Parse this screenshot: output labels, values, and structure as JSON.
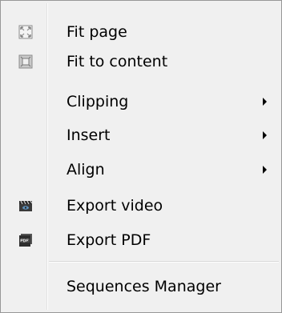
{
  "menu": {
    "items": [
      {
        "label": "Fit page",
        "icon": "fit-page-icon",
        "submenu": false
      },
      {
        "label": "Fit to content",
        "icon": "fit-to-content-icon",
        "submenu": false
      },
      {
        "label": "Clipping",
        "icon": "",
        "submenu": true
      },
      {
        "label": "Insert",
        "icon": "",
        "submenu": true
      },
      {
        "label": "Align",
        "icon": "",
        "submenu": true
      },
      {
        "label": "Export video",
        "icon": "clapperboard-icon",
        "submenu": false
      },
      {
        "label": "Export PDF",
        "icon": "pdf-icon",
        "submenu": false
      },
      {
        "label": "Sequences Manager",
        "icon": "",
        "submenu": false
      }
    ]
  },
  "colors": {
    "menu_background": "#f0f0f0",
    "menu_border": "#979797",
    "separator": "#d7d7d7"
  }
}
